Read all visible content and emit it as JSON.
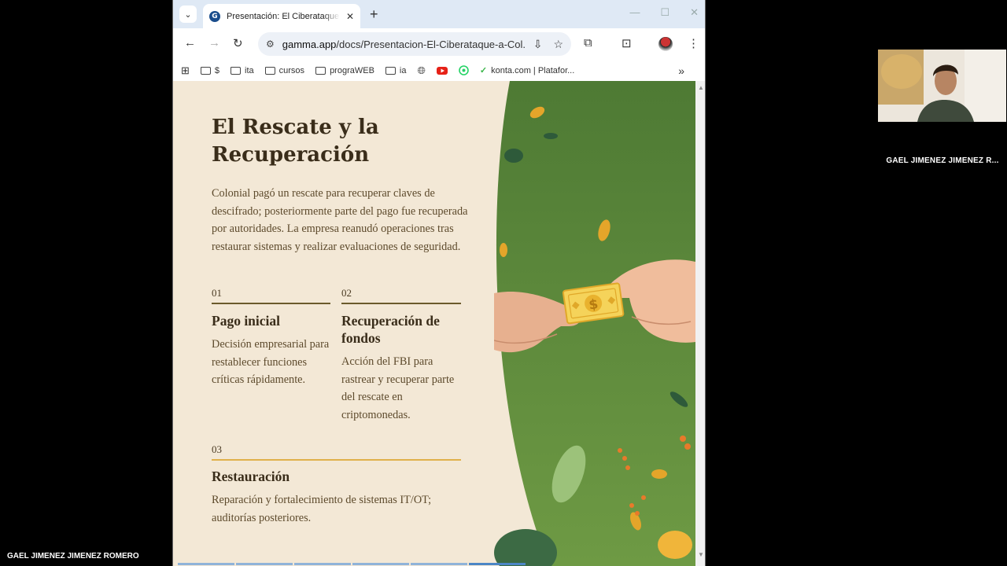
{
  "browser": {
    "tab_title": "Presentación: El Ciberataque a C",
    "tab_favicon_letter": "G",
    "url_host": "gamma.app",
    "url_path": "/docs/Presentacion-El-Ciberataque-a-Col...",
    "bookmarks": [
      {
        "label": "$",
        "icon": "folder-icon"
      },
      {
        "label": "ita",
        "icon": "folder-icon"
      },
      {
        "label": "cursos",
        "icon": "folder-icon"
      },
      {
        "label": "prograWEB",
        "icon": "folder-icon"
      },
      {
        "label": "ia",
        "icon": "folder-icon"
      },
      {
        "label": "",
        "icon": "globe-icon"
      },
      {
        "label": "",
        "icon": "youtube-icon"
      },
      {
        "label": "",
        "icon": "whatsapp-icon"
      },
      {
        "label": "konta.com | Platafor...",
        "icon": "konta-icon"
      }
    ]
  },
  "slide": {
    "title": "El Rescate y la Recuperación",
    "lead": "Colonial pagó un rescate para recuperar claves de descifrado; posteriormente parte del pago fue recuperada por autoridades. La empresa reanudó operaciones tras restaurar sistemas y realizar evaluaciones de seguridad.",
    "sections": [
      {
        "num": "01",
        "heading": "Pago inicial",
        "body": "Decisión empresarial para restablecer funciones críticas rápidamente.",
        "rule_color": "#6b5a2c"
      },
      {
        "num": "02",
        "heading": "Recuperación de fondos",
        "body": "Acción del FBI para rastrear y recuperar parte del rescate en criptomonedas.",
        "rule_color": "#6b5a2c"
      },
      {
        "num": "03",
        "heading": "Restauración",
        "body": "Reparación y fortalecimiento de sistemas IT/OT; auditorías posteriores.",
        "rule_color": "#e0b04a"
      }
    ],
    "money_symbol": "$"
  },
  "meeting": {
    "participant_name": "GAEL JIMENEZ JIMENEZ R...",
    "self_name": "GAEL JIMENEZ JIMENEZ ROMERO"
  },
  "colors": {
    "page_bg": "#f3e8d6",
    "heading": "#3a2d1a",
    "body": "#5d4a2c",
    "art_green": "#5e8a3c"
  }
}
